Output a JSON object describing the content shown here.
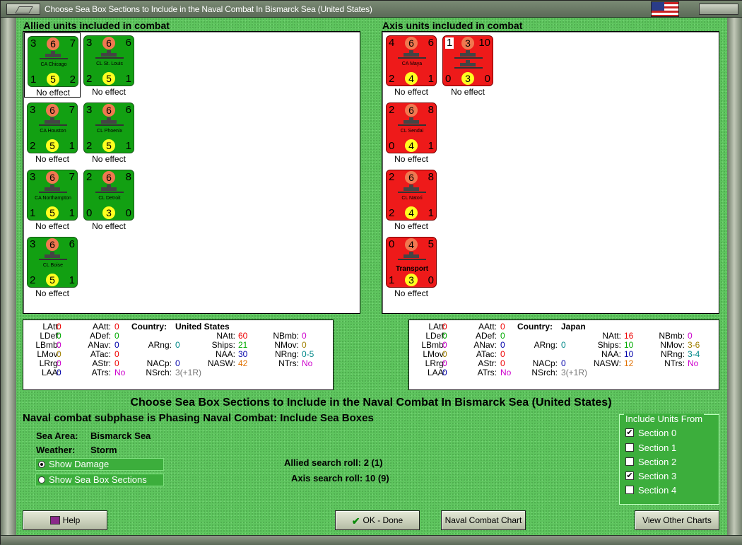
{
  "window": {
    "title": "Choose Sea Box Sections to Include in the Naval Combat In Bismarck Sea (United States)"
  },
  "allied": {
    "heading": "Allied units included in combat",
    "units": [
      {
        "tl": "3",
        "top": "6",
        "tr": "7",
        "name": "CA Chicago",
        "bl": "1",
        "bot": "5",
        "br": "2",
        "effect": "No effect"
      },
      {
        "tl": "3",
        "top": "6",
        "tr": "6",
        "name": "CL St. Louis",
        "bl": "2",
        "bot": "5",
        "br": "1",
        "effect": "No effect"
      },
      {
        "tl": "3",
        "top": "6",
        "tr": "7",
        "name": "CA Houston",
        "bl": "2",
        "bot": "5",
        "br": "1",
        "effect": "No effect"
      },
      {
        "tl": "3",
        "top": "6",
        "tr": "6",
        "name": "CL Phoenix",
        "bl": "2",
        "bot": "5",
        "br": "1",
        "effect": "No effect"
      },
      {
        "tl": "3",
        "top": "6",
        "tr": "7",
        "name": "CA Northampton",
        "bl": "1",
        "bot": "5",
        "br": "1",
        "effect": "No effect"
      },
      {
        "tl": "2",
        "top": "6",
        "tr": "8",
        "name": "CL Detroit",
        "bl": "0",
        "bot": "3",
        "br": "0",
        "effect": "No effect"
      },
      {
        "tl": "3",
        "top": "6",
        "tr": "6",
        "name": "CL Boise",
        "bl": "2",
        "bot": "5",
        "br": "1",
        "effect": "No effect"
      }
    ]
  },
  "axis": {
    "heading": "Axis units included in combat",
    "units": [
      {
        "tl": "4",
        "top": "6",
        "tr": "6",
        "name": "CA Maya",
        "bl": "2",
        "bot": "4",
        "br": "1",
        "effect": "No effect"
      },
      {
        "tl": "1",
        "top": "3",
        "tr": "10",
        "name": "",
        "bl": "0",
        "bot": "3",
        "br": "0",
        "effect": "No effect"
      },
      {
        "tl": "2",
        "top": "6",
        "tr": "8",
        "name": "CL Sendai",
        "bl": "0",
        "bot": "4",
        "br": "1",
        "effect": "No effect"
      },
      {
        "tl": "2",
        "top": "6",
        "tr": "8",
        "name": "CL Natori",
        "bl": "2",
        "bot": "4",
        "br": "1",
        "effect": "No effect"
      },
      {
        "tl": "0",
        "top": "4",
        "tr": "5",
        "name": "Transport",
        "bl": "1",
        "bot": "3",
        "br": "0",
        "effect": "No effect"
      }
    ]
  },
  "stats_us": {
    "latt": "0",
    "ldef": "0",
    "lbmb": "0",
    "lmov": "0",
    "lrg": "0",
    "laa": "0",
    "aatt": "0",
    "adef": "0",
    "anav": "0",
    "atac": "0",
    "astr": "0",
    "atrs": "No",
    "country_label": "Country:",
    "country": "United States",
    "arng": "0",
    "nacp": "0",
    "natt": "60",
    "ships": "21",
    "naa": "30",
    "nasw": "42",
    "nsrch": "3(+1R)",
    "nbmb": "0",
    "nmov": "0",
    "nrng": "0-5",
    "ntrs": "No"
  },
  "stats_jp": {
    "latt": "0",
    "ldef": "0",
    "lbmb": "0",
    "lmov": "0",
    "lrg": "0",
    "laa": "0",
    "aatt": "0",
    "adef": "0",
    "anav": "0",
    "atac": "0",
    "astr": "0",
    "atrs": "No",
    "country_label": "Country:",
    "country": "Japan",
    "arng": "0",
    "nacp": "0",
    "natt": "16",
    "ships": "10",
    "naa": "10",
    "nasw": "12",
    "nsrch": "3(+1R)",
    "nbmb": "0",
    "nmov": "3-6",
    "nrng": "3-4",
    "ntrs": "No"
  },
  "labels": {
    "latt": "LAtt:",
    "ldef": "LDef:",
    "lbmb": "LBmb:",
    "lmov": "LMov:",
    "lrg": "LRrg:",
    "laa": "LAA:",
    "aatt": "AAtt:",
    "adef": "ADef:",
    "anav": "ANav:",
    "atac": "ATac:",
    "astr": "AStr:",
    "atrs": "ATrs:",
    "arng": "ARng:",
    "nacp": "NACp:",
    "natt": "NAtt:",
    "ships": "Ships:",
    "naa": "NAA:",
    "nasw": "NASW:",
    "nsrch": "NSrch:",
    "nbmb": "NBmb:",
    "nmov": "NMov:",
    "nrng": "NRng:",
    "ntrs": "NTrs:"
  },
  "main": {
    "title": "Choose Sea Box Sections to Include in the Naval Combat In Bismarck Sea (United States)",
    "subphase": "Naval combat subphase is Phasing Naval Combat: Include Sea Boxes",
    "sea_area_label": "Sea Area:",
    "sea_area": "Bismarck Sea",
    "weather_label": "Weather:",
    "weather": "Storm",
    "show_damage": "Show Damage",
    "show_sections": "Show Sea Box Sections",
    "allied_roll": "Allied search roll: 2 (1)",
    "axis_roll": "Axis search roll: 10 (9)"
  },
  "include": {
    "title": "Include Units From",
    "sections": [
      {
        "label": "Section 0",
        "checked": true
      },
      {
        "label": "Section 1",
        "checked": false
      },
      {
        "label": "Section 2",
        "checked": false
      },
      {
        "label": "Section 3",
        "checked": true
      },
      {
        "label": "Section 4",
        "checked": false
      }
    ]
  },
  "buttons": {
    "help": "Help",
    "ok": "OK - Done",
    "naval_chart": "Naval Combat Chart",
    "other_charts": "View Other Charts"
  },
  "colors": {
    "allied_card": "#12a012",
    "axis_card": "#ee1a1a",
    "background": "#5ec45e"
  }
}
